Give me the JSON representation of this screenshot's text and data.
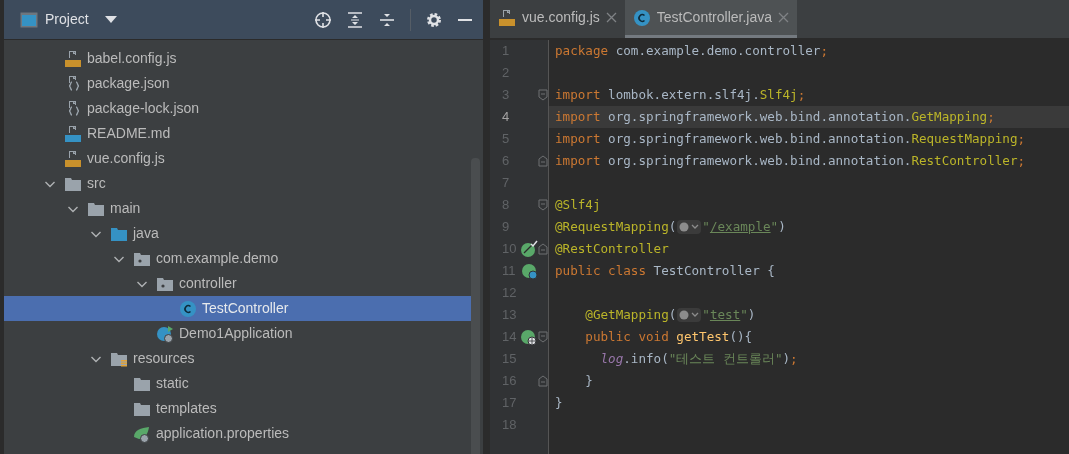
{
  "project_panel": {
    "title": "Project",
    "tree": [
      {
        "label": "babel.config.js",
        "kind": "js",
        "selected": false
      },
      {
        "label": "package.json",
        "kind": "json",
        "selected": false
      },
      {
        "label": "package-lock.json",
        "kind": "json",
        "selected": false
      },
      {
        "label": "README.md",
        "kind": "md",
        "selected": false
      },
      {
        "label": "vue.config.js",
        "kind": "js",
        "selected": false
      },
      {
        "label": "src",
        "kind": "folder",
        "selected": false,
        "expanded": true,
        "children": [
          {
            "label": "main",
            "kind": "folder",
            "selected": false,
            "expanded": true,
            "children": [
              {
                "label": "java",
                "kind": "source",
                "selected": false,
                "expanded": true,
                "children": [
                  {
                    "label": "com.example.demo",
                    "kind": "package",
                    "selected": false,
                    "expanded": true,
                    "children": [
                      {
                        "label": "controller",
                        "kind": "package",
                        "selected": false,
                        "expanded": true,
                        "children": [
                          {
                            "label": "TestController",
                            "kind": "class",
                            "selected": true
                          }
                        ]
                      },
                      {
                        "label": "Demo1Application",
                        "kind": "boot",
                        "selected": false
                      }
                    ]
                  }
                ]
              },
              {
                "label": "resources",
                "kind": "resources",
                "selected": false,
                "expanded": true,
                "children": [
                  {
                    "label": "static",
                    "kind": "folder",
                    "selected": false
                  },
                  {
                    "label": "templates",
                    "kind": "folder",
                    "selected": false
                  },
                  {
                    "label": "application.properties",
                    "kind": "properties",
                    "selected": false
                  }
                ]
              }
            ]
          }
        ]
      }
    ]
  },
  "editor": {
    "tabs": [
      {
        "label": "vue.config.js",
        "kind": "js",
        "selected": false
      },
      {
        "label": "TestController.java",
        "kind": "class",
        "selected": true
      }
    ],
    "lines": [
      {
        "number": "1",
        "current": false,
        "tokens": [
          {
            "kind": "keyword",
            "text": "package "
          },
          {
            "kind": "plain",
            "text": "com.example.demo.controller"
          },
          {
            "kind": "keyword",
            "text": ";"
          }
        ]
      },
      {
        "number": "2",
        "current": false
      },
      {
        "number": "3",
        "current": false,
        "fold": {
          "kind": "start"
        },
        "tokens": [
          {
            "kind": "keyword",
            "text": "import "
          },
          {
            "kind": "plain",
            "text": "lombok.extern.slf4j."
          },
          {
            "kind": "annotation",
            "text": "Slf4j"
          },
          {
            "kind": "keyword",
            "text": ";"
          }
        ]
      },
      {
        "number": "4",
        "current": true,
        "tokens": [
          {
            "kind": "keyword",
            "text": "import "
          },
          {
            "kind": "plain",
            "text": "org.springframework.web.bind.annotation."
          },
          {
            "kind": "annotation",
            "text": "GetMapping"
          },
          {
            "kind": "keyword",
            "text": ";"
          }
        ]
      },
      {
        "number": "5",
        "current": false,
        "tokens": [
          {
            "kind": "keyword",
            "text": "import "
          },
          {
            "kind": "plain",
            "text": "org.springframework.web.bind.annotation."
          },
          {
            "kind": "annotation",
            "text": "RequestMapping"
          },
          {
            "kind": "keyword",
            "text": ";"
          }
        ]
      },
      {
        "number": "6",
        "current": false,
        "fold": {
          "kind": "end"
        },
        "tokens": [
          {
            "kind": "keyword",
            "text": "import "
          },
          {
            "kind": "plain",
            "text": "org.springframework.web.bind.annotation."
          },
          {
            "kind": "annotation",
            "text": "RestController"
          },
          {
            "kind": "keyword",
            "text": ";"
          }
        ]
      },
      {
        "number": "7",
        "current": false
      },
      {
        "number": "8",
        "current": false,
        "fold": {
          "kind": "start"
        },
        "tokens": [
          {
            "kind": "annotation",
            "text": "@Slf4j"
          }
        ]
      },
      {
        "number": "9",
        "current": false,
        "tokens": [
          {
            "kind": "annotation",
            "text": "@RequestMapping"
          },
          {
            "kind": "plain",
            "text": "("
          },
          {
            "kind": "hint"
          },
          {
            "kind": "string",
            "text": "\""
          },
          {
            "kind": "link",
            "text": "/example"
          },
          {
            "kind": "string",
            "text": "\""
          },
          {
            "kind": "plain",
            "text": ")"
          }
        ]
      },
      {
        "number": "10",
        "current": false,
        "fold": {
          "kind": "end"
        },
        "gutter": {
          "kind": "bean"
        },
        "tokens": [
          {
            "kind": "annotation",
            "text": "@RestController"
          }
        ]
      },
      {
        "number": "11",
        "current": false,
        "gutter": {
          "kind": "bean-class"
        },
        "tokens": [
          {
            "kind": "keyword",
            "text": "public class "
          },
          {
            "kind": "plain",
            "text": "TestController {"
          }
        ]
      },
      {
        "number": "12",
        "current": false
      },
      {
        "number": "13",
        "current": false,
        "tokens": [
          {
            "kind": "annotation",
            "text": "    @GetMapping"
          },
          {
            "kind": "plain",
            "text": "("
          },
          {
            "kind": "hint"
          },
          {
            "kind": "string",
            "text": "\""
          },
          {
            "kind": "link",
            "text": "test"
          },
          {
            "kind": "string",
            "text": "\""
          },
          {
            "kind": "plain",
            "text": ")"
          }
        ]
      },
      {
        "number": "14",
        "current": false,
        "fold": {
          "kind": "start"
        },
        "gutter": {
          "kind": "web"
        },
        "tokens": [
          {
            "kind": "keyword",
            "text": "    public void "
          },
          {
            "kind": "method",
            "text": "getTest"
          },
          {
            "kind": "plain",
            "text": "(){"
          }
        ]
      },
      {
        "number": "15",
        "current": false,
        "tokens": [
          {
            "kind": "field",
            "text": "      log"
          },
          {
            "kind": "plain",
            "text": ".info("
          },
          {
            "kind": "string",
            "text": "\"테스트 컨트롤러\""
          },
          {
            "kind": "plain",
            "text": ")"
          },
          {
            "kind": "keyword",
            "text": ";"
          }
        ]
      },
      {
        "number": "16",
        "current": false,
        "fold": {
          "kind": "end"
        },
        "tokens": [
          {
            "kind": "plain",
            "text": "    }"
          }
        ]
      },
      {
        "number": "17",
        "current": false,
        "tokens": [
          {
            "kind": "plain",
            "text": "}"
          }
        ]
      },
      {
        "number": "18",
        "current": false
      }
    ]
  }
}
